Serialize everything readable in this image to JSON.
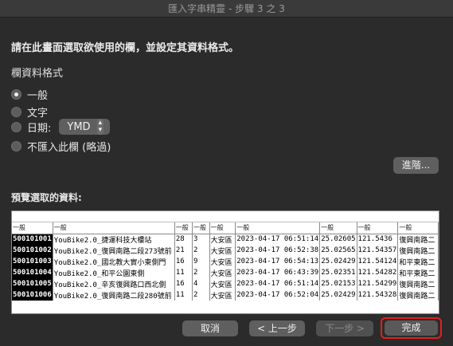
{
  "window": {
    "title": "匯入字串精靈 - 步驟 3 之 3"
  },
  "instruction": "請在此畫面選取欲使用的欄，並設定其資料格式。",
  "column_format": {
    "title": "欄資料格式",
    "options": [
      {
        "label": "一般",
        "selected": true
      },
      {
        "label": "文字",
        "selected": false
      },
      {
        "label": "日期:",
        "selected": false
      },
      {
        "label": "不匯入此欄 (略過)",
        "selected": false
      }
    ],
    "date_format": "YMD"
  },
  "advanced_label": "進階...",
  "preview": {
    "title": "預覽選取的資料:",
    "headers": [
      "一般",
      "一般",
      "一般",
      "一般",
      "一般",
      "一般",
      "一般",
      "一般",
      "一般"
    ],
    "rows": [
      [
        "500101001",
        "YouBike2.0_捷運科技大樓站",
        "28",
        "3",
        "大安區",
        "2023-04-17 06:51:14",
        "25.02605",
        "121.5436",
        "復興南路二"
      ],
      [
        "500101002",
        "YouBike2.0_復興南路二段273號前",
        "21",
        "2",
        "大安區",
        "2023-04-17 06:52:38",
        "25.02565",
        "121.54357",
        "復興南路二"
      ],
      [
        "500101003",
        "YouBike2.0_國北教大實小東側門",
        "16",
        "9",
        "大安區",
        "2023-04-17 06:54:13",
        "25.02429",
        "121.54124",
        "和平東路二"
      ],
      [
        "500101004",
        "YouBike2.0_和平公園東側",
        "11",
        "2",
        "大安區",
        "2023-04-17 06:43:39",
        "25.02351",
        "121.54282",
        "和平東路二"
      ],
      [
        "500101005",
        "YouBike2.0_辛亥復興路口西北側",
        "16",
        "4",
        "大安區",
        "2023-04-17 06:51:14",
        "25.02153",
        "121.54299",
        "復興南路二"
      ],
      [
        "500101006",
        "YouBike2.0_復興南路二段280號前",
        "11",
        "2",
        "大安區",
        "2023-04-17 06:52:04",
        "25.02429",
        "121.54328",
        "復興南路二"
      ]
    ]
  },
  "buttons": {
    "cancel": "取消",
    "back": "< 上一步",
    "next": "下一步 >",
    "finish": "完成"
  },
  "colors": {
    "highlight": "#e0201f",
    "background": "#2b2b2b"
  }
}
